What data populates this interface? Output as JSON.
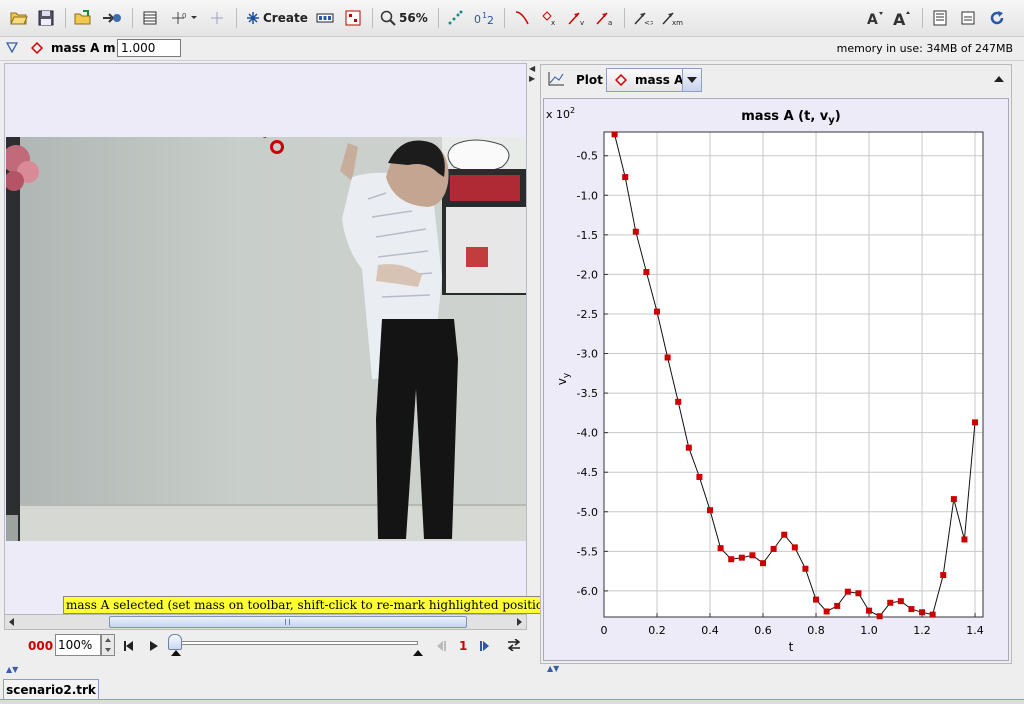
{
  "toolbar": {
    "create_label": "Create",
    "zoom_label": "56%"
  },
  "trackbar": {
    "track_name": "mass A",
    "mass_label": "m",
    "mass_value": "1.000",
    "memory_text": "memory in use: 34MB of 247MB"
  },
  "video": {
    "point_label": "0"
  },
  "status": {
    "message": "mass A selected (set mass on toolbar, shift-click to re-mark highlighted position)"
  },
  "player": {
    "frame_counter": "000",
    "zoom_value": "100%",
    "step_size": "1"
  },
  "plot_panel": {
    "plot_label": "Plot",
    "track_select": "mass A"
  },
  "file_tab": "scenario2.trk",
  "colors": {
    "accent_red": "#cc0000",
    "plot_bg": "#ffffff",
    "panel_bg": "#ecebf7"
  },
  "chart_data": {
    "type": "line",
    "title_main": "mass A (t, v",
    "title_sub": "y",
    "title_end": ")",
    "xlabel": "t",
    "ylabel_main": "v",
    "ylabel_sub": "y",
    "exponent_base": "x 10",
    "exponent_power": "2",
    "xlim": [
      0,
      1.43
    ],
    "ylim": [
      -6.33,
      -0.2
    ],
    "xticks": [
      0,
      0.2,
      0.4,
      0.6,
      0.8,
      1.0,
      1.2,
      1.4
    ],
    "xtick_labels": [
      "0",
      "0.2",
      "0.4",
      "0.6",
      "0.8",
      "1.0",
      "1.2",
      "1.4"
    ],
    "yticks": [
      -0.5,
      -1.0,
      -1.5,
      -2.0,
      -2.5,
      -3.0,
      -3.5,
      -4.0,
      -4.5,
      -5.0,
      -5.5,
      -6.0
    ],
    "ytick_labels": [
      "-0.5",
      "-1.0",
      "-1.5",
      "-2.0",
      "-2.5",
      "-3.0",
      "-3.5",
      "-4.0",
      "-4.5",
      "-5.0",
      "-5.5",
      "-6.0"
    ],
    "grid": true,
    "series": [
      {
        "x": [
          0.04,
          0.08,
          0.12,
          0.16,
          0.2,
          0.24,
          0.28,
          0.32,
          0.36,
          0.4,
          0.44,
          0.48,
          0.52,
          0.56,
          0.6,
          0.64,
          0.68,
          0.72,
          0.76,
          0.8,
          0.84,
          0.88,
          0.92,
          0.96,
          1.0,
          1.04,
          1.08,
          1.12,
          1.16,
          1.2,
          1.24,
          1.28,
          1.32,
          1.36,
          1.4
        ],
        "y": [
          -0.23,
          -0.77,
          -1.46,
          -1.97,
          -2.47,
          -3.05,
          -3.61,
          -4.19,
          -4.56,
          -4.98,
          -5.46,
          -5.6,
          -5.58,
          -5.55,
          -5.65,
          -5.47,
          -5.29,
          -5.45,
          -5.72,
          -6.11,
          -6.26,
          -6.19,
          -6.01,
          -6.03,
          -6.25,
          -6.32,
          -6.15,
          -6.13,
          -6.23,
          -6.27,
          -6.3,
          -5.8,
          -4.84,
          -5.35,
          -3.87
        ]
      }
    ]
  }
}
